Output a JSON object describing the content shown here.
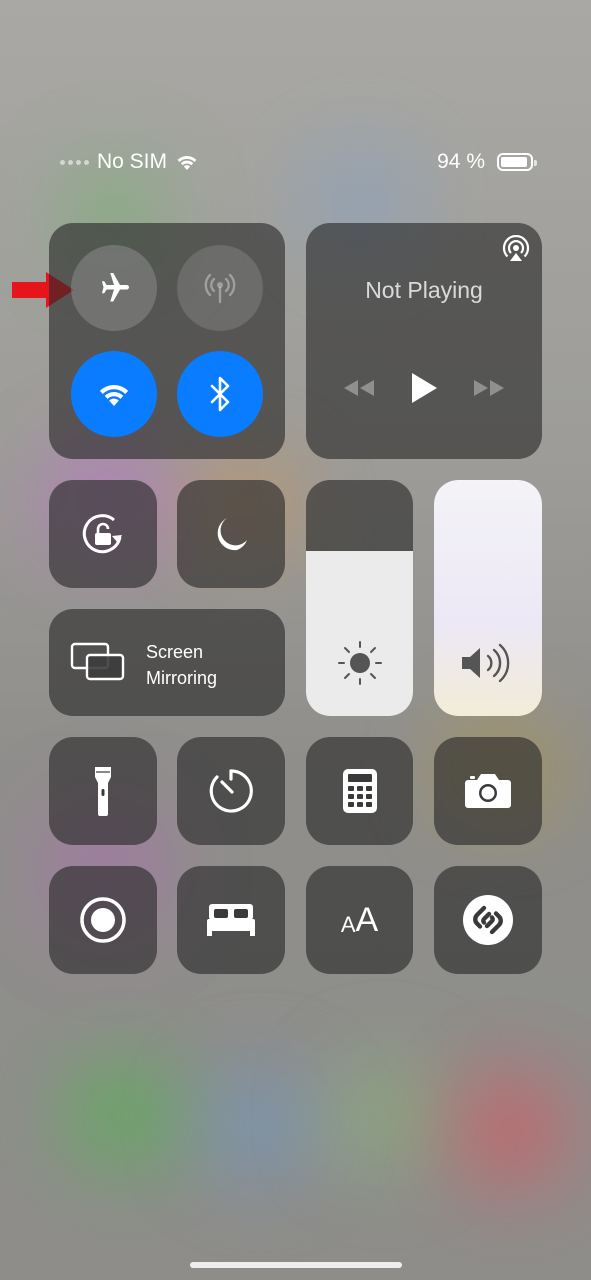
{
  "status_bar": {
    "carrier": "No SIM",
    "battery_percent": "94 %",
    "battery_level": 0.94
  },
  "connectivity": {
    "airplane_mode": {
      "icon": "airplane-icon",
      "state": "off"
    },
    "cellular_data": {
      "icon": "antenna-icon",
      "state": "disabled"
    },
    "wifi": {
      "icon": "wifi-icon",
      "state": "on"
    },
    "bluetooth": {
      "icon": "bluetooth-icon",
      "state": "on"
    }
  },
  "now_playing": {
    "title": "Not Playing",
    "airplay_icon": "airplay-icon",
    "controls": [
      "rewind-icon",
      "play-icon",
      "fast-forward-icon"
    ]
  },
  "tiles": {
    "rotation_lock": "rotation-lock-icon",
    "do_not_disturb": "moon-icon",
    "screen_mirroring_line1": "Screen",
    "screen_mirroring_line2": "Mirroring"
  },
  "sliders": {
    "brightness_level": 0.7,
    "volume_level": 1.0
  },
  "bottom_row1": [
    "flashlight-icon",
    "timer-icon",
    "calculator-icon",
    "camera-icon"
  ],
  "bottom_row2": [
    "screen-record-icon",
    "bed-icon",
    "text-size-icon",
    "shazam-icon"
  ],
  "text_size_label": "AA",
  "colors": {
    "accent_blue": "#0a7cff",
    "annotation_arrow": "#e8141c"
  }
}
